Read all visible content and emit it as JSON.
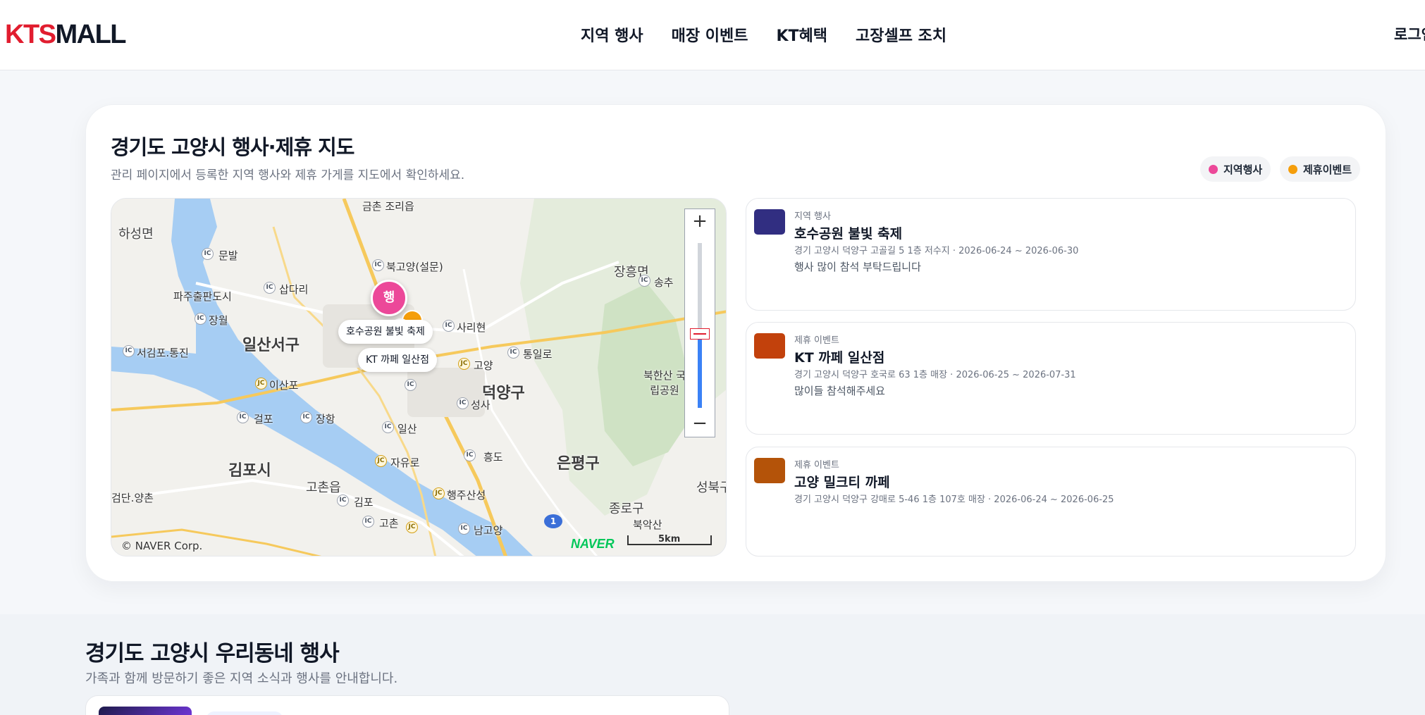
{
  "header": {
    "logo_accent": "KTS",
    "logo_rest": "MALL",
    "nav": [
      "지역 행사",
      "매장 이벤트",
      "KT혜택",
      "고장셀프 조치"
    ],
    "login": "로그인"
  },
  "map_section": {
    "title": "경기도 고양시 행사·제휴 지도",
    "subtitle": "관리 페이지에서 등록한 지역 행사와 제휴 가게를 지도에서 확인하세요.",
    "legend": [
      {
        "label": "지역행사",
        "color": "#ec4899"
      },
      {
        "label": "제휴이벤트",
        "color": "#f59e0b"
      }
    ]
  },
  "map": {
    "places": [
      "하성면",
      "금촌 조리읍",
      "문발",
      "파주출판도시",
      "삽다리",
      "북고양(설문)",
      "장흥면",
      "송추",
      "장월",
      "일산서구",
      "사리현",
      "서김포.통진",
      "통일로",
      "이산포",
      "고양",
      "덕양구",
      "북한산 국립공원",
      "걸포",
      "장항",
      "성사",
      "일산",
      "김포시",
      "자유로",
      "흥도",
      "은평구",
      "고촌읍",
      "검단.양촌",
      "김포",
      "행주산성",
      "고촌",
      "남고양",
      "종로구",
      "북악산",
      "성북구"
    ],
    "event_marker": "행",
    "tag_event": "호수공원 불빛 축제",
    "tag_partner": "KT 까페 일산점",
    "zoom_in": "+",
    "zoom_out": "−",
    "zoom_level_fraction": 0.45,
    "copyright": "© NAVER Corp.",
    "provider": "NAVER",
    "scale": "5km",
    "route_shield": "1"
  },
  "list": [
    {
      "category": "지역 행사",
      "title": "호수공원 불빛 축제",
      "meta": "경기 고양시 덕양구 고골길 5 1층 저수지 · 2026-06-24 ~ 2026-06-30",
      "desc": "행사 많이 참석 부탁드립니다",
      "thumb_color": "#312e81"
    },
    {
      "category": "제휴 이벤트",
      "title": "KT 까페 일산점",
      "meta": "경기 고양시 덕양구 호국로 63 1층 매장 · 2026-06-25 ~ 2026-07-31",
      "desc": "많이들 참석해주세요",
      "thumb_color": "#c2410c"
    },
    {
      "category": "제휴 이벤트",
      "title": "고양 밀크티 까페",
      "meta": "경기 고양시 덕양구 강매로 5-46 1층 107호 매장 · 2026-06-24 ~ 2026-06-25",
      "desc": "",
      "thumb_color": "#b45309"
    }
  ],
  "local_section": {
    "title": "경기도 고양시 우리동네 행사",
    "subtitle": "가족과 함께 방문하기 좋은 지역 소식과 행사를 안내합니다."
  }
}
